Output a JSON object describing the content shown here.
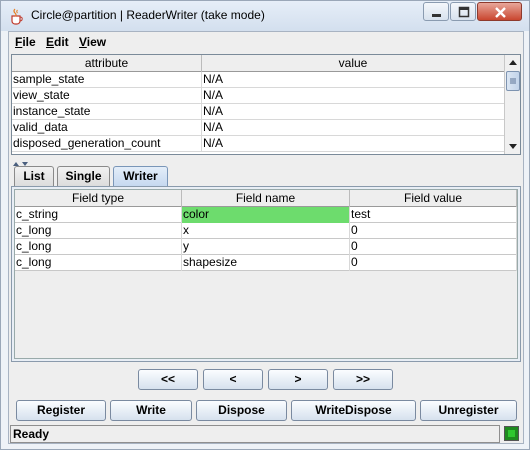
{
  "window": {
    "title": "Circle@partition | ReaderWriter (take mode)",
    "icons": {
      "app": "java-cup-icon",
      "minimize": "minimize-icon",
      "maximize": "maximize-icon",
      "close": "close-icon"
    }
  },
  "menubar": {
    "items": [
      {
        "label": "File",
        "mnemonic": "F",
        "rest": "ile"
      },
      {
        "label": "Edit",
        "mnemonic": "E",
        "rest": "dit"
      },
      {
        "label": "View",
        "mnemonic": "V",
        "rest": "iew"
      }
    ]
  },
  "attributes": {
    "columns": [
      "attribute",
      "value"
    ],
    "rows": [
      {
        "attribute": "sample_state",
        "value": "N/A"
      },
      {
        "attribute": "view_state",
        "value": "N/A"
      },
      {
        "attribute": "instance_state",
        "value": "N/A"
      },
      {
        "attribute": "valid_data",
        "value": "N/A"
      },
      {
        "attribute": "disposed_generation_count",
        "value": "N/A"
      }
    ]
  },
  "tabs": [
    {
      "label": "List",
      "active": false
    },
    {
      "label": "Single",
      "active": false
    },
    {
      "label": "Writer",
      "active": true
    }
  ],
  "fields": {
    "columns": [
      "Field type",
      "Field name",
      "Field value"
    ],
    "rows": [
      {
        "type": "c_string",
        "name": "color",
        "value": "test",
        "highlight": true
      },
      {
        "type": "c_long",
        "name": "x",
        "value": "0",
        "highlight": false
      },
      {
        "type": "c_long",
        "name": "y",
        "value": "0",
        "highlight": false
      },
      {
        "type": "c_long",
        "name": "shapesize",
        "value": "0",
        "highlight": false
      }
    ]
  },
  "navigation": {
    "first": "<<",
    "prev": "<",
    "next": ">",
    "last": ">>"
  },
  "actions": {
    "register": "Register",
    "write": "Write",
    "dispose": "Dispose",
    "write_dispose": "WriteDispose",
    "unregister": "Unregister"
  },
  "status": {
    "text": "Ready",
    "indicator_color": "#2fc72f"
  },
  "colors": {
    "highlight": "#6ddc6d",
    "titlebar": "#d3dfee",
    "close_button": "#c9462f"
  }
}
